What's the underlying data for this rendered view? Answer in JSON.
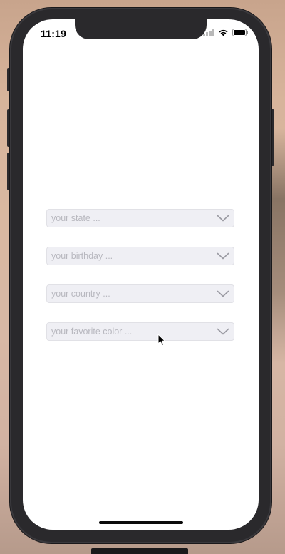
{
  "status_bar": {
    "time": "11:19"
  },
  "dropdowns": [
    {
      "placeholder": "your state ..."
    },
    {
      "placeholder": "your birthday ..."
    },
    {
      "placeholder": "your country ..."
    },
    {
      "placeholder": "your favorite color ..."
    }
  ],
  "colors": {
    "field_background": "#efeff4",
    "placeholder_text": "#b8b8bf",
    "chevron": "#9a9aa2",
    "device_frame": "#2a292c"
  }
}
